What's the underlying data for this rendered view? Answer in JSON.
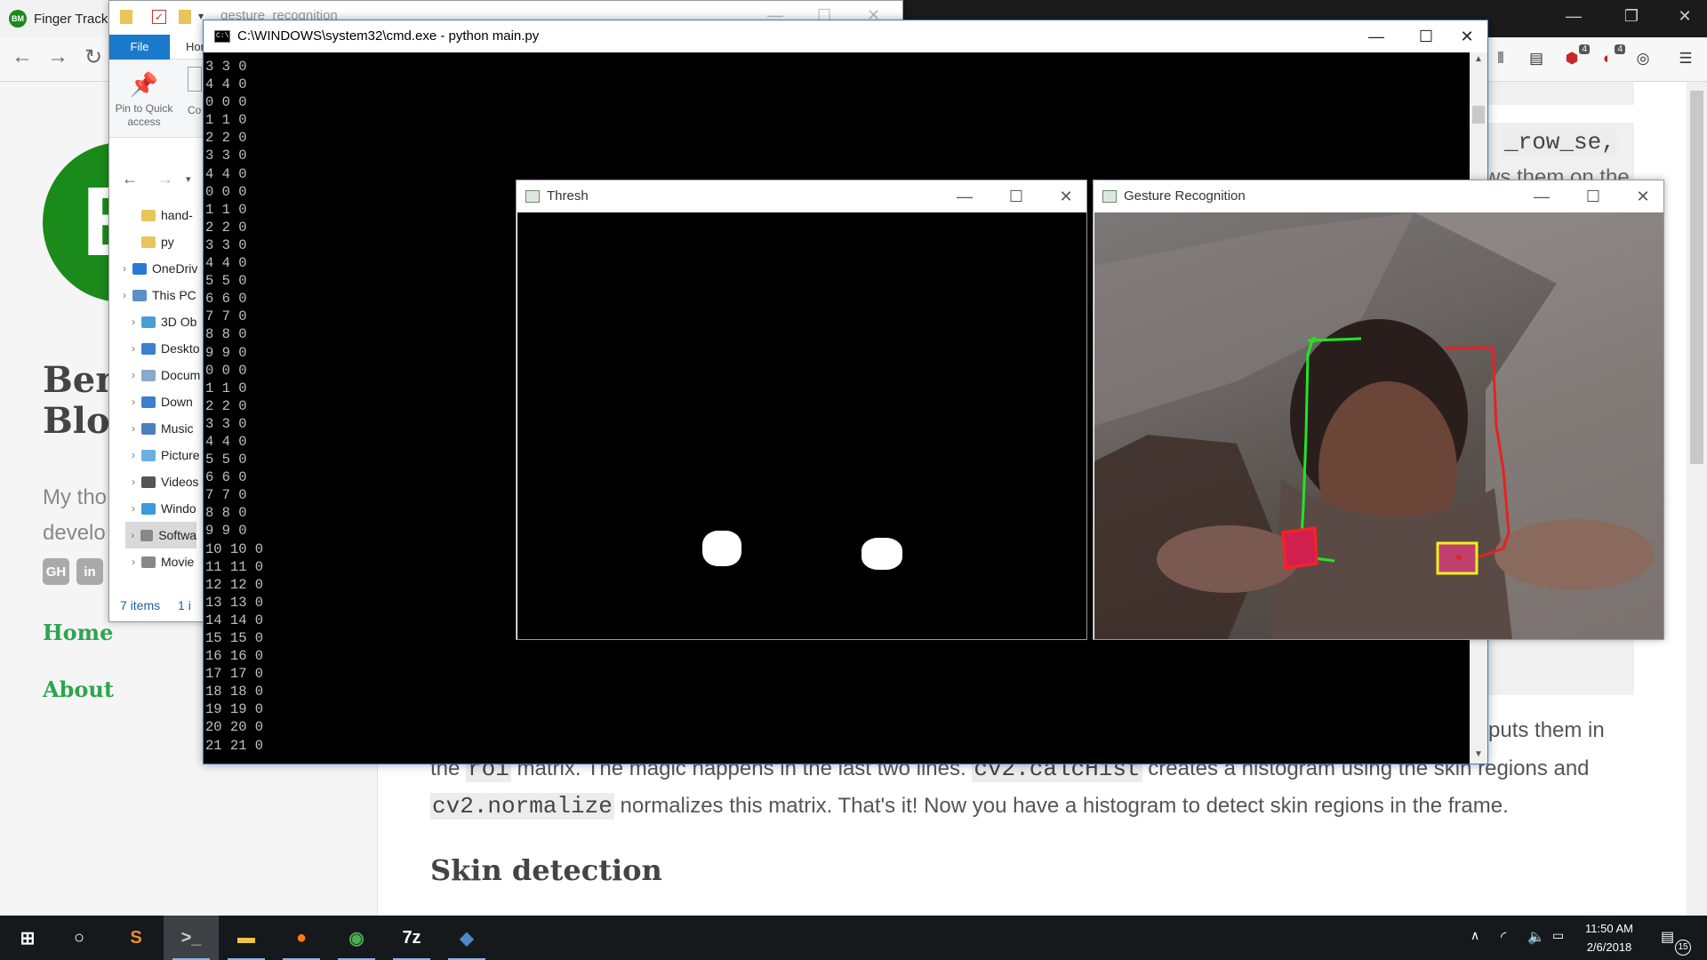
{
  "browser": {
    "tab_title": "Finger Tracking",
    "favicon_text": "BM",
    "badges": [
      "4",
      "4"
    ]
  },
  "blog": {
    "logo_letter": "B",
    "title": "Ben\nBlog",
    "description": "My tho\ndevelo",
    "social": [
      "GH",
      "in"
    ],
    "nav": [
      "Home",
      "About"
    ]
  },
  "article": {
    "code_row_se": "_row_se,",
    "partial_line": "ws them on the",
    "puts_text": "puts them in",
    "line1_a": "the",
    "line1_code1": "roi",
    "line1_b": "matrix. The magic happens in the last two lines.",
    "line1_code2": "cv2.calcHist",
    "line1_c": "creates a histogram using the skin regions and",
    "line2_code": "cv2.normalize",
    "line2_text": "normalizes this matrix. That's it! Now you have a histogram to detect skin regions in the frame.",
    "heading": "Skin detection"
  },
  "explorer": {
    "title": "gesture_recognition",
    "file_tab": "File",
    "home_tab": "Hor",
    "pin_label": "Pin to Quick access",
    "copy_label": "Co",
    "status": "7 items",
    "status2": "1 i",
    "tree": [
      {
        "label": "hand-",
        "icon": "folder-icon",
        "color": "#e8c45a",
        "indent": 1,
        "chevron": false
      },
      {
        "label": "py",
        "icon": "folder-icon",
        "color": "#e8c45a",
        "indent": 1,
        "chevron": false
      },
      {
        "label": "OneDriv",
        "icon": "cloud-icon",
        "color": "#2b79d6",
        "indent": 0,
        "chevron": true
      },
      {
        "label": "This PC",
        "icon": "computer-icon",
        "color": "#5b8fc7",
        "indent": 0,
        "chevron": true
      },
      {
        "label": "3D Ob",
        "icon": "cube-icon",
        "color": "#4a9ed6",
        "indent": 1,
        "chevron": true
      },
      {
        "label": "Deskto",
        "icon": "desktop-icon",
        "color": "#3b7fd0",
        "indent": 1,
        "chevron": true
      },
      {
        "label": "Docum",
        "icon": "document-icon",
        "color": "#8aa8c8",
        "indent": 1,
        "chevron": true
      },
      {
        "label": "Down",
        "icon": "download-icon",
        "color": "#3b7fd0",
        "indent": 1,
        "chevron": true
      },
      {
        "label": "Music",
        "icon": "music-icon",
        "color": "#4a7fc0",
        "indent": 1,
        "chevron": true
      },
      {
        "label": "Picture",
        "icon": "pictures-icon",
        "color": "#6ab0e0",
        "indent": 1,
        "chevron": true
      },
      {
        "label": "Videos",
        "icon": "video-icon",
        "color": "#555555",
        "indent": 1,
        "chevron": true
      },
      {
        "label": "Windo",
        "icon": "windows-drive-icon",
        "color": "#3b9ad9",
        "indent": 1,
        "chevron": true
      },
      {
        "label": "Softwa",
        "icon": "drive-icon",
        "color": "#888888",
        "indent": 1,
        "chevron": true
      },
      {
        "label": "Movie",
        "icon": "drive-icon",
        "color": "#888888",
        "indent": 1,
        "chevron": true
      }
    ]
  },
  "cmd": {
    "title": "C:\\WINDOWS\\system32\\cmd.exe - python  main.py",
    "icon_text": "C:\\",
    "lines": [
      "3 3 0",
      "4 4 0",
      "0 0 0",
      "1 1 0",
      "2 2 0",
      "3 3 0",
      "4 4 0",
      "0 0 0",
      "1 1 0",
      "2 2 0",
      "3 3 0",
      "4 4 0",
      "5 5 0",
      "6 6 0",
      "7 7 0",
      "8 8 0",
      "9 9 0",
      "0 0 0",
      "1 1 0",
      "2 2 0",
      "3 3 0",
      "4 4 0",
      "5 5 0",
      "6 6 0",
      "7 7 0",
      "8 8 0",
      "9 9 0",
      "10 10 0",
      "11 11 0",
      "12 12 0",
      "13 13 0",
      "14 14 0",
      "15 15 0",
      "16 16 0",
      "17 17 0",
      "18 18 0",
      "19 19 0",
      "20 20 0",
      "21 21 0"
    ]
  },
  "thresh": {
    "title": "Thresh"
  },
  "gesture": {
    "title": "Gesture Recognition"
  },
  "taskbar": {
    "apps": [
      {
        "name": "start-button",
        "glyph": "⊞",
        "color": "#ffffff"
      },
      {
        "name": "cortana-button",
        "glyph": "○",
        "color": "#ffffff"
      },
      {
        "name": "sublime-text-app",
        "glyph": "S",
        "color": "#f28c28"
      },
      {
        "name": "command-prompt-app",
        "glyph": ">_",
        "color": "#cccccc"
      },
      {
        "name": "file-explorer-app",
        "glyph": "▬",
        "color": "#f0c24a"
      },
      {
        "name": "firefox-app",
        "glyph": "●",
        "color": "#ff7a1a"
      },
      {
        "name": "chrome-app",
        "glyph": "◉",
        "color": "#4caf50"
      },
      {
        "name": "7zip-app",
        "glyph": "7z",
        "color": "#ffffff"
      },
      {
        "name": "python-app",
        "glyph": "◆",
        "color": "#4a8ac8"
      }
    ],
    "time": "11:50 AM",
    "date": "2/6/2018",
    "notification_count": "15"
  }
}
